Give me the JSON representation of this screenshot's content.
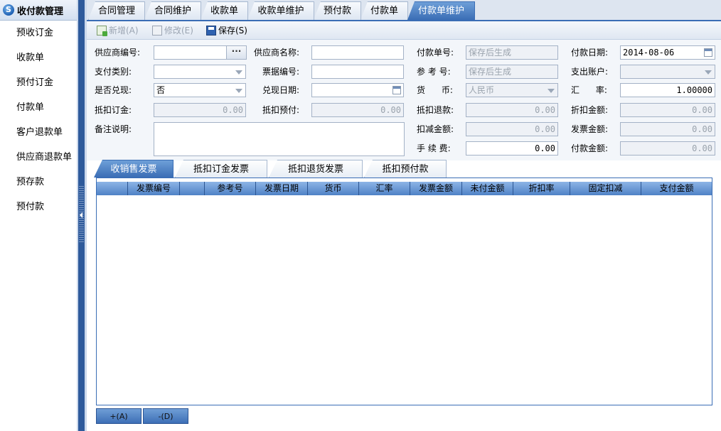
{
  "sidebar": {
    "title": "收付款管理",
    "logo": "S",
    "items": [
      "预收订金",
      "收款单",
      "预付订金",
      "付款单",
      "客户退款单",
      "供应商退款单",
      "预存款",
      "预付款"
    ]
  },
  "tabs": [
    "合同管理",
    "合同维护",
    "收款单",
    "收款单维护",
    "预付款",
    "付款单",
    "付款单维护"
  ],
  "active_tab": "付款单维护",
  "toolbar": {
    "add": "新增(A)",
    "edit": "修改(E)",
    "save": "保存(S)"
  },
  "form": {
    "supplier_code_label": "供应商编号:",
    "supplier_name_label": "供应商名称:",
    "payment_no_label": "付款单号:",
    "payment_no_placeholder": "保存后生成",
    "payment_date_label": "付款日期:",
    "payment_date": "2014-08-06",
    "pay_type_label": "支付类别:",
    "bill_no_label": "票据编号:",
    "ref_no_label": "参 考 号:",
    "ref_no_placeholder": "保存后生成",
    "expense_account_label": "支出账户:",
    "is_cashed_label": "是否兑现:",
    "is_cashed": "否",
    "cash_date_label": "兑现日期:",
    "currency_label": "货      币:",
    "currency": "人民币",
    "exchange_rate_label": "汇      率:",
    "exchange_rate": "1.00000",
    "offset_deposit_label": "抵扣订金:",
    "offset_deposit": "0.00",
    "offset_prepay_label": "抵扣预付:",
    "offset_prepay": "0.00",
    "offset_refund_label": "抵扣退款:",
    "offset_refund": "0.00",
    "discount_amount_label": "折扣金额:",
    "discount_amount": "0.00",
    "remark_label": "备注说明:",
    "deduct_amount_label": "扣减金额:",
    "deduct_amount": "0.00",
    "invoice_amount_label": "发票金额:",
    "invoice_amount": "0.00",
    "fee_label": "手 续 费:",
    "fee": "0.00",
    "pay_amount_label": "付款金额:",
    "pay_amount": "0.00",
    "ellipsis": "···"
  },
  "subtabs": [
    "收销售发票",
    "抵扣订金发票",
    "抵扣退货发票",
    "抵扣预付款"
  ],
  "active_subtab": "收销售发票",
  "grid": {
    "columns": [
      "",
      "发票编号",
      "",
      "参考号",
      "发票日期",
      "货币",
      "汇率",
      "发票金额",
      "未付金额",
      "折扣率",
      "固定扣减",
      "支付金额"
    ]
  },
  "bottom": {
    "add": "+(A)",
    "del": "-(D)"
  }
}
